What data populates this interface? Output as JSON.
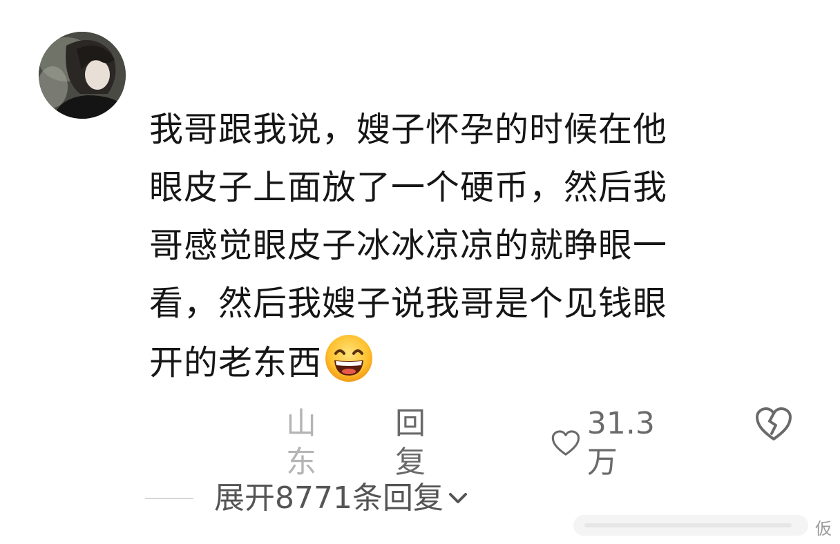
{
  "comment": {
    "lines": [
      "我哥跟我说，嫂子怀孕的时候在他",
      "眼皮子上面放了一个硬币，然后我",
      "哥感觉眼皮子冰冰凉凉的就睁眼一",
      "看，然后我嫂子说我哥是个见钱眼",
      "开的老东西"
    ],
    "emoji": "grinning-face"
  },
  "meta": {
    "location": "山东",
    "reply_label": "回复",
    "like_count": "31.3万"
  },
  "expand": {
    "label": "展开8771条回复"
  },
  "watermark": {
    "text": "仮"
  },
  "colors": {
    "text_primary": "#161616",
    "text_secondary": "#6a6a6a",
    "text_muted": "#b4b4b4",
    "background": "#ffffff"
  }
}
